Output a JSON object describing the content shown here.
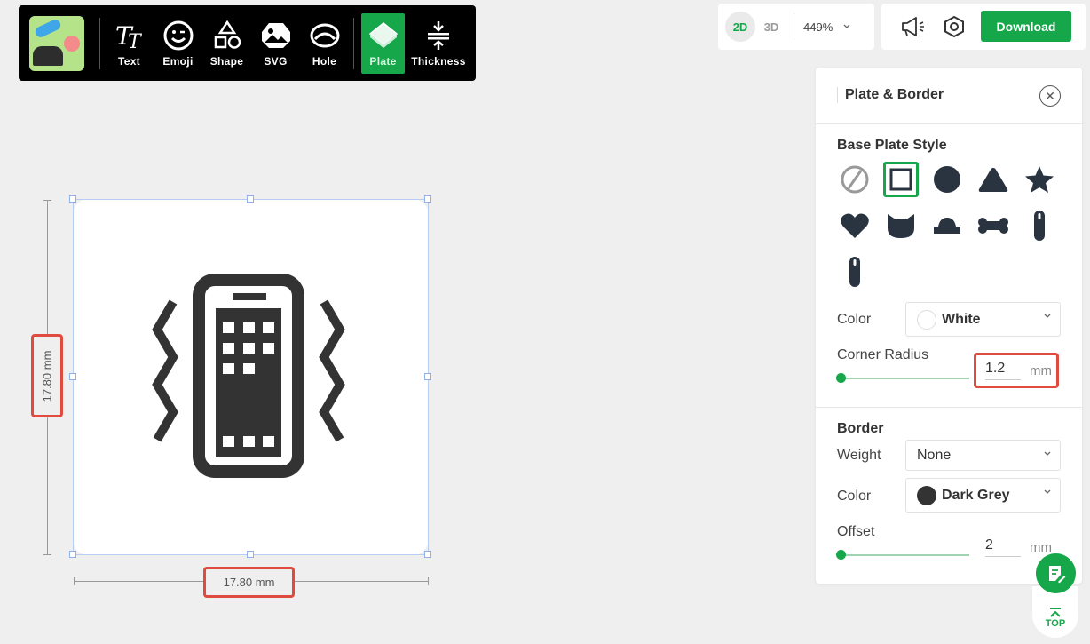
{
  "toolbar": {
    "tools": [
      {
        "label": "Text",
        "icon": "text-icon"
      },
      {
        "label": "Emoji",
        "icon": "emoji-icon"
      },
      {
        "label": "Shape",
        "icon": "shape-icon"
      },
      {
        "label": "SVG",
        "icon": "svg-icon"
      },
      {
        "label": "Hole",
        "icon": "hole-icon"
      },
      {
        "label": "Plate",
        "icon": "plate-icon",
        "active": true
      },
      {
        "label": "Thickness",
        "icon": "thickness-icon"
      }
    ]
  },
  "view": {
    "mode_2d": "2D",
    "mode_3d": "3D",
    "zoom": "449%"
  },
  "actions": {
    "download": "Download"
  },
  "canvas": {
    "width_label": "17.80 mm",
    "height_label": "17.80 mm"
  },
  "panel": {
    "title": "Plate & Border",
    "base_plate_style": "Base Plate Style",
    "shapes": [
      "none",
      "square",
      "circle",
      "triangle",
      "star",
      "heart",
      "cat",
      "dome",
      "bone",
      "tag-tall",
      "tag-short"
    ],
    "selected_shape": "square",
    "color_label": "Color",
    "color_value": "White",
    "corner_radius_label": "Corner Radius",
    "corner_radius_value": "1.2",
    "corner_radius_unit": "mm",
    "border_title": "Border",
    "weight_label": "Weight",
    "weight_value": "None",
    "border_color_label": "Color",
    "border_color_value": "Dark Grey",
    "offset_label": "Offset",
    "offset_value": "2",
    "offset_unit": "mm"
  },
  "footer": {
    "top_label": "TOP"
  },
  "colors": {
    "accent": "#15a74a",
    "highlight": "#e04b3f",
    "dark_grey": "#333333"
  }
}
